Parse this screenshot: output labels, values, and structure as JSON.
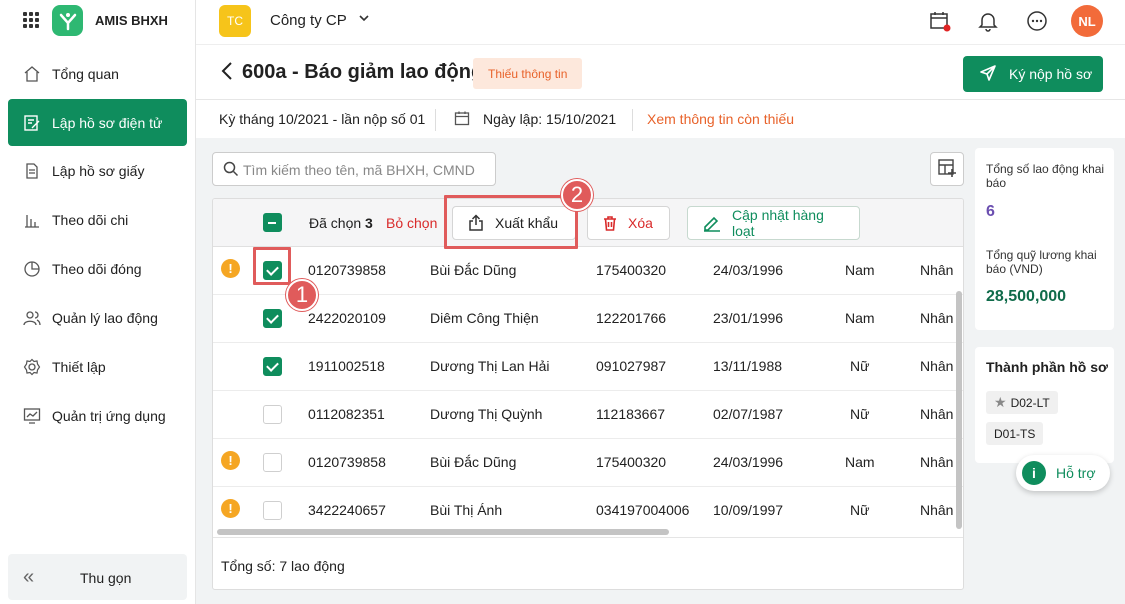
{
  "app": {
    "brand": "AMIS BHXH"
  },
  "sidebar": {
    "items": [
      {
        "label": "Tổng quan",
        "icon": "home-icon"
      },
      {
        "label": "Lập hồ sơ điện tử",
        "icon": "document-edit-icon",
        "active": true
      },
      {
        "label": "Lập hồ sơ giấy",
        "icon": "paper-document-icon"
      },
      {
        "label": "Theo dõi chi",
        "icon": "bar-chart-icon"
      },
      {
        "label": "Theo dõi đóng",
        "icon": "pie-chart-icon"
      },
      {
        "label": "Quản lý lao động",
        "icon": "people-icon"
      },
      {
        "label": "Thiết lập",
        "icon": "gear-icon"
      },
      {
        "label": "Quản trị ứng dụng",
        "icon": "monitor-chart-icon"
      }
    ],
    "collapse_label": "Thu gọn"
  },
  "topbar": {
    "company_badge": "TC",
    "company_name": "Công ty CP",
    "avatar": "NL"
  },
  "page": {
    "title": "600a - Báo giảm lao động",
    "status_badge": "Thiếu thông tin",
    "submit_label": "Ký nộp hồ sơ",
    "period": "Kỳ tháng 10/2021 - lần nộp số 01",
    "created_date": "Ngày lập: 15/10/2021",
    "missing_link": "Xem thông tin còn thiếu"
  },
  "search": {
    "placeholder": "Tìm kiếm theo tên, mã BHXH, CMND"
  },
  "toolbar": {
    "selected_prefix": "Đã chọn",
    "selected_count": "3",
    "deselect": "Bỏ chọn",
    "export": "Xuất khẩu",
    "delete": "Xóa",
    "bulk_update": "Cập nhật hàng loạt"
  },
  "rows": [
    {
      "alert": true,
      "checked": true,
      "code": "0120739858",
      "name": "Bùi Đắc Dũng",
      "id": "175400320",
      "dob": "24/03/1996",
      "gender": "Nam",
      "extra": "Nhân"
    },
    {
      "alert": false,
      "checked": true,
      "code": "2422020109",
      "name": "Diêm Công Thiện",
      "id": "122201766",
      "dob": "23/01/1996",
      "gender": "Nam",
      "extra": "Nhân"
    },
    {
      "alert": false,
      "checked": true,
      "code": "1911002518",
      "name": "Dương Thị Lan Hải",
      "id": "091027987",
      "dob": "13/11/1988",
      "gender": "Nữ",
      "extra": "Nhân"
    },
    {
      "alert": false,
      "checked": false,
      "code": "0112082351",
      "name": "Dương Thị Quỳnh",
      "id": "112183667",
      "dob": "02/07/1987",
      "gender": "Nữ",
      "extra": "Nhân"
    },
    {
      "alert": true,
      "checked": false,
      "code": "0120739858",
      "name": "Bùi Đắc Dũng",
      "id": "175400320",
      "dob": "24/03/1996",
      "gender": "Nam",
      "extra": "Nhân"
    },
    {
      "alert": true,
      "checked": false,
      "code": "3422240657",
      "name": "Bùi Thị Ánh",
      "id": "034197004006",
      "dob": "10/09/1997",
      "gender": "Nữ",
      "extra": "Nhân"
    }
  ],
  "footer": {
    "total": "Tổng số: 7 lao động"
  },
  "summary": {
    "employees_label": "Tổng số lao động khai báo",
    "employees_value": "6",
    "salary_label": "Tổng quỹ lương khai báo (VND)",
    "salary_value": "28,500,000"
  },
  "components": {
    "title": "Thành phần hồ sơ",
    "chips": [
      "D02-LT",
      "D01-TS"
    ]
  },
  "help": {
    "label": "Hỗ trợ"
  },
  "annotations": [
    "1",
    "2"
  ],
  "colors": {
    "primary": "#0f8d5d",
    "danger": "#d92b2b",
    "warning": "#e8622a",
    "alert": "#f5a623",
    "annotation": "#e05b5b"
  }
}
